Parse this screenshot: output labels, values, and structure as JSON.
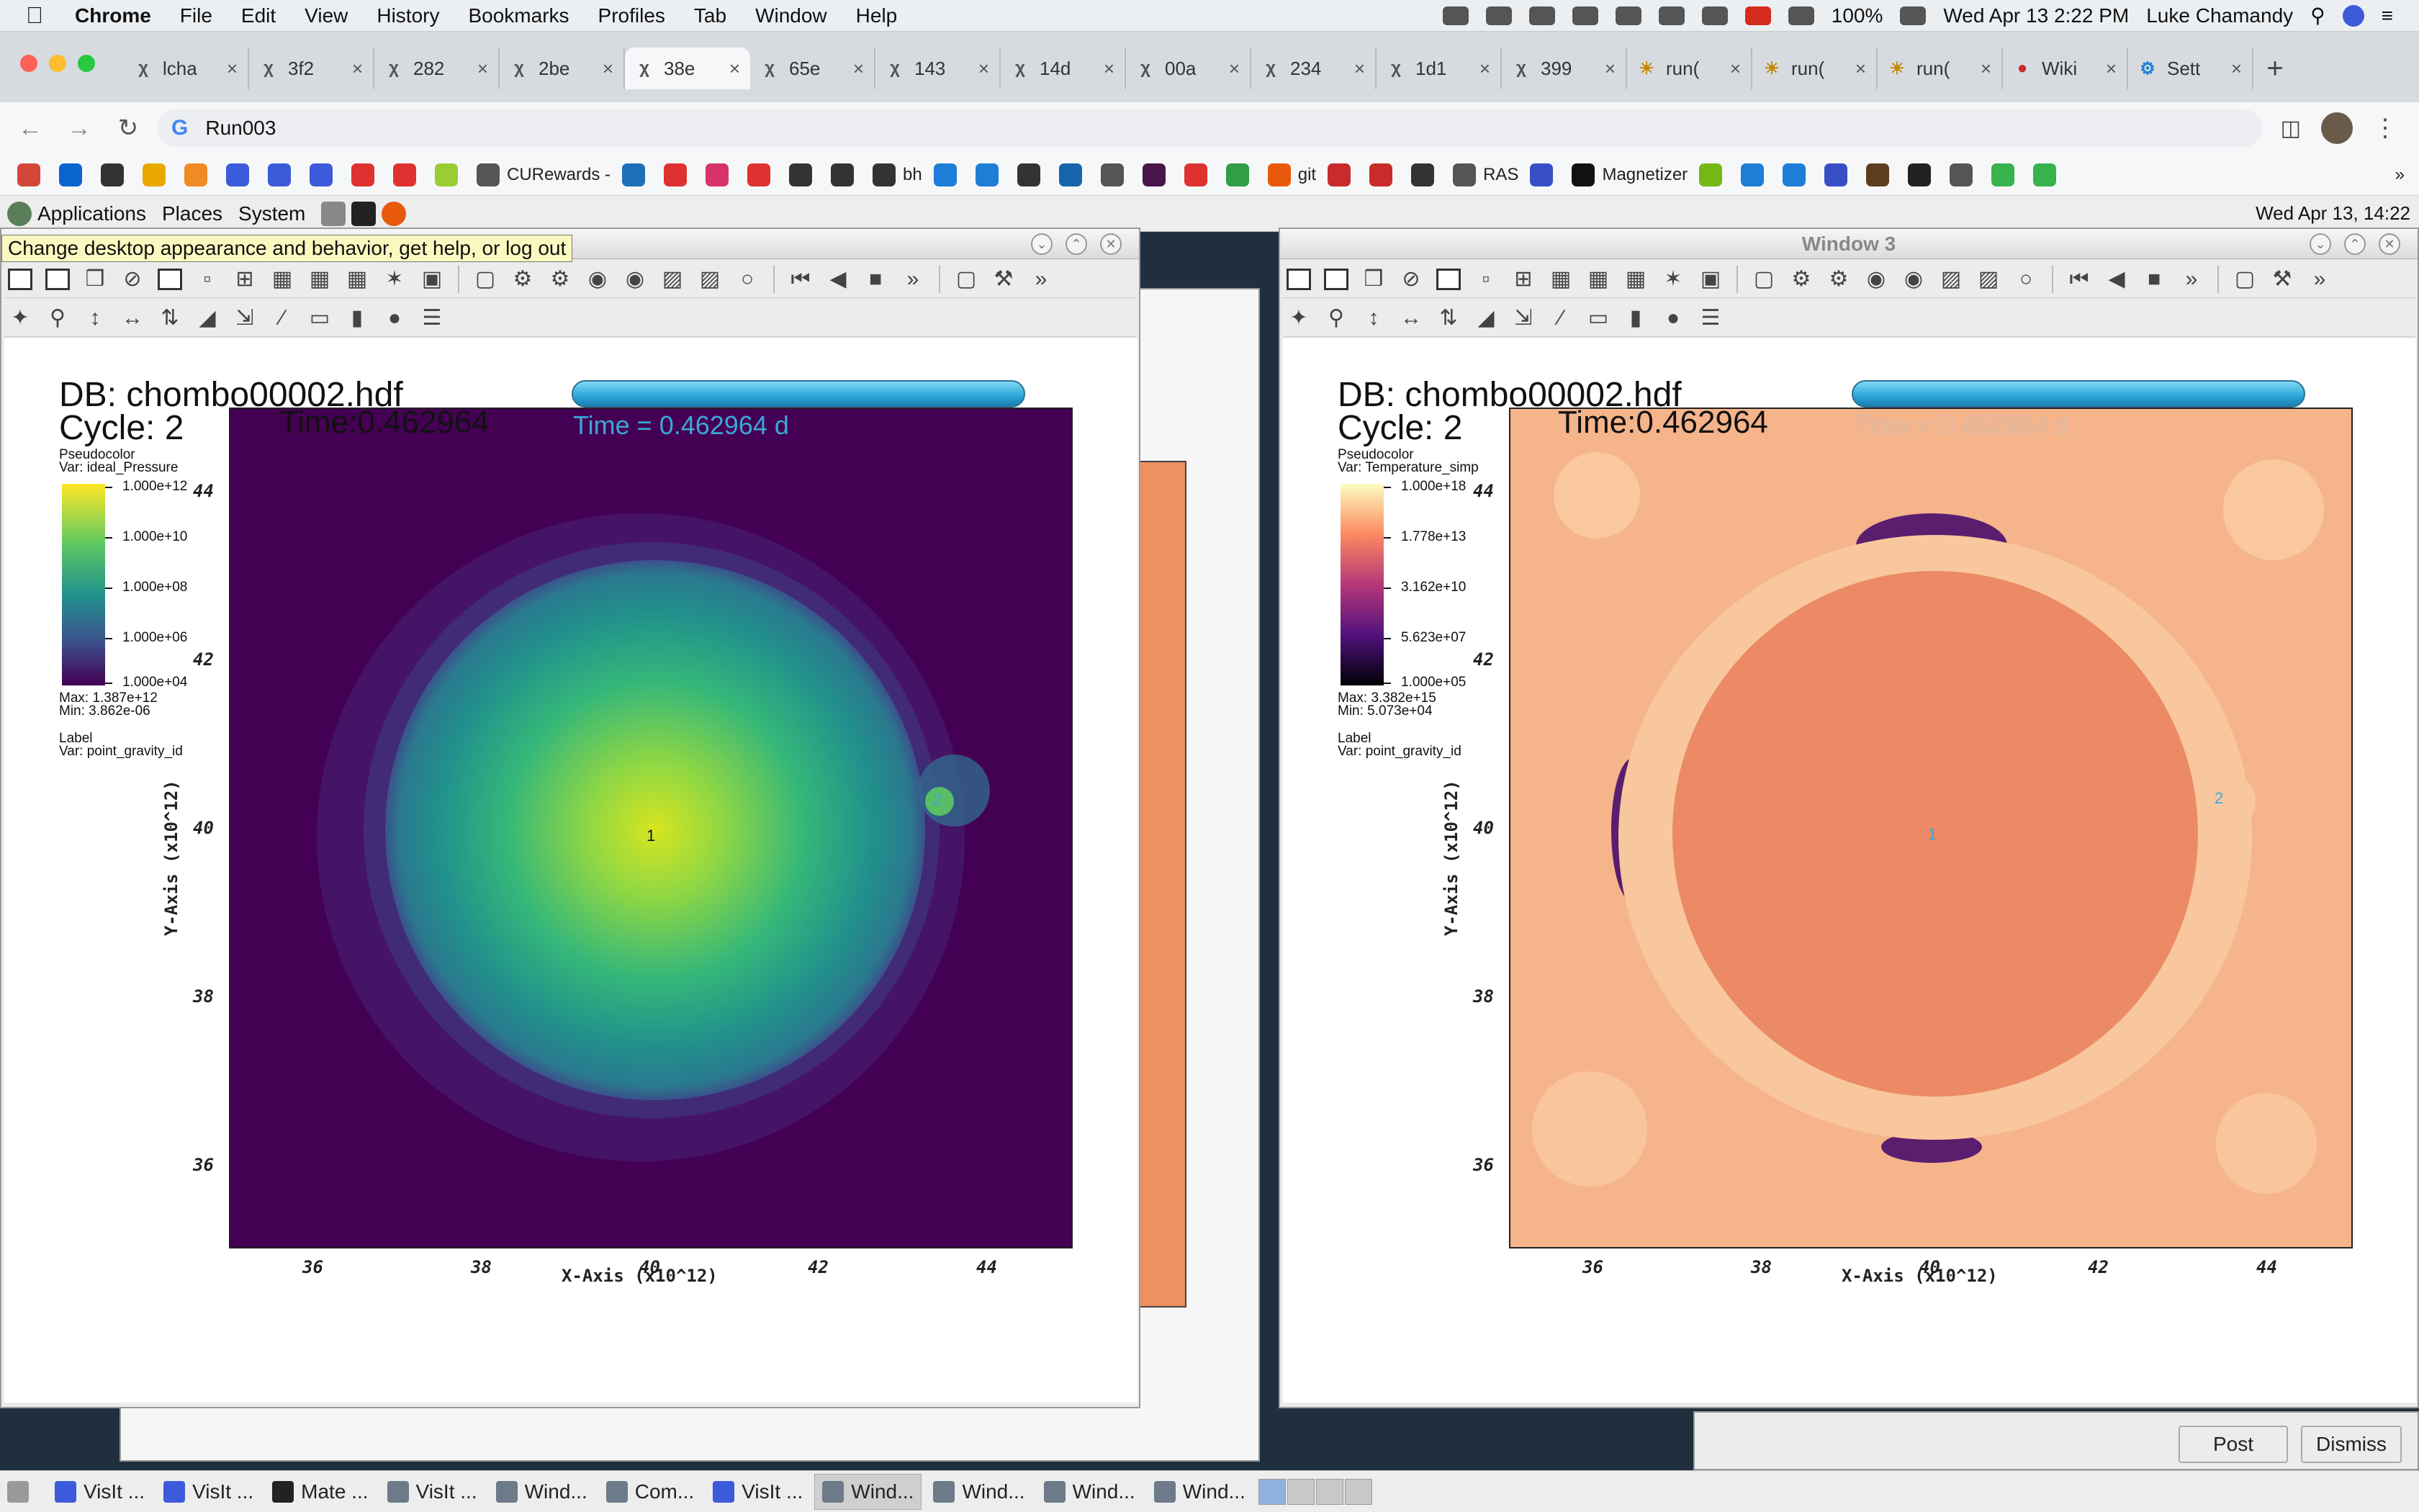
{
  "menubar": {
    "app": "Chrome",
    "items": [
      "File",
      "Edit",
      "View",
      "History",
      "Bookmarks",
      "Profiles",
      "Tab",
      "Window",
      "Help"
    ],
    "battery": "100%",
    "datetime": "Wed Apr 13  2:22 PM",
    "user": "Luke Chamandy"
  },
  "tabs": [
    {
      "label": "lcha",
      "icon": "x"
    },
    {
      "label": "3f2 ",
      "icon": "x"
    },
    {
      "label": "282",
      "icon": "x"
    },
    {
      "label": "2be",
      "icon": "x"
    },
    {
      "label": "38e",
      "icon": "x",
      "active": true
    },
    {
      "label": "65e",
      "icon": "x"
    },
    {
      "label": "143",
      "icon": "x"
    },
    {
      "label": "14d",
      "icon": "x"
    },
    {
      "label": "00a",
      "icon": "x"
    },
    {
      "label": "234",
      "icon": "x"
    },
    {
      "label": "1d1",
      "icon": "x"
    },
    {
      "label": "399",
      "icon": "x"
    },
    {
      "label": "run(",
      "icon": "sun"
    },
    {
      "label": "run(",
      "icon": "sun"
    },
    {
      "label": "run(",
      "icon": "sun"
    },
    {
      "label": "Wiki",
      "icon": "paw"
    },
    {
      "label": "Sett",
      "icon": "gear"
    }
  ],
  "address": {
    "url": "Run003"
  },
  "bookmarks": [
    {
      "label": "",
      "color": "#d44638"
    },
    {
      "label": "",
      "color": "#0a64d0"
    },
    {
      "label": "",
      "color": "#333"
    },
    {
      "label": "",
      "color": "#e8a800"
    },
    {
      "label": "",
      "color": "#f08a24"
    },
    {
      "label": "",
      "color": "#3b5bdb"
    },
    {
      "label": "",
      "color": "#3b5bdb"
    },
    {
      "label": "",
      "color": "#3b5bdb"
    },
    {
      "label": "",
      "color": "#e03131"
    },
    {
      "label": "",
      "color": "#e03131"
    },
    {
      "label": "",
      "color": "#9acd32"
    },
    {
      "label": "CURewards -",
      "color": "#555"
    },
    {
      "label": "",
      "color": "#1e6fb8"
    },
    {
      "label": "",
      "color": "#e03131"
    },
    {
      "label": "",
      "color": "#d6336c"
    },
    {
      "label": "",
      "color": "#e03131"
    },
    {
      "label": "",
      "color": "#333"
    },
    {
      "label": "",
      "color": "#333"
    },
    {
      "label": "bh",
      "color": "#333"
    },
    {
      "label": "",
      "color": "#1c7ed6"
    },
    {
      "label": "",
      "color": "#1c7ed6"
    },
    {
      "label": "",
      "color": "#333"
    },
    {
      "label": "",
      "color": "#1864ab"
    },
    {
      "label": "",
      "color": "#555"
    },
    {
      "label": "",
      "color": "#4a154b"
    },
    {
      "label": "",
      "color": "#e03131"
    },
    {
      "label": "",
      "color": "#2f9e44"
    },
    {
      "label": "git",
      "color": "#e8590c"
    },
    {
      "label": "",
      "color": "#c92a2a"
    },
    {
      "label": "",
      "color": "#c92a2a"
    },
    {
      "label": "",
      "color": "#333"
    },
    {
      "label": "RAS",
      "color": "#555"
    },
    {
      "label": "",
      "color": "#364fc7"
    },
    {
      "label": "Magnetizer",
      "color": "#111"
    },
    {
      "label": "",
      "color": "#74b816"
    },
    {
      "label": "",
      "color": "#1c7ed6"
    },
    {
      "label": "",
      "color": "#1c7ed6"
    },
    {
      "label": "",
      "color": "#364fc7"
    },
    {
      "label": "",
      "color": "#5c3d1e"
    },
    {
      "label": "",
      "color": "#222"
    },
    {
      "label": "",
      "color": "#555"
    },
    {
      "label": "",
      "color": "#37b24d"
    },
    {
      "label": "",
      "color": "#37b24d"
    }
  ],
  "gnome": {
    "items": [
      "Applications",
      "Places",
      "System"
    ],
    "clock": "Wed Apr 13, 14:22"
  },
  "tooltip": "Change desktop appearance and behavior, get help, or log out",
  "left_window": {
    "db": "DB: chombo00002.hdf",
    "cycle": "Cycle: 2",
    "time": "Time:0.462964",
    "time_annotation": "Time = 0.462964 d",
    "legend": {
      "plot": "Pseudocolor",
      "var": "Var: ideal_Pressure",
      "ticks": [
        "1.000e+12",
        "1.000e+10",
        "1.000e+08",
        "1.000e+06",
        "1.000e+04"
      ],
      "max": "Max:  1.387e+12",
      "min": "Min:  3.862e-06",
      "label": "Label",
      "label_var": "Var: point_gravity_id"
    }
  },
  "right_window": {
    "title": "Window 3",
    "db": "DB: chombo00002.hdf",
    "cycle": "Cycle: 2",
    "time": "Time:0.462964",
    "time_annotation": "Time = 0.462964 d",
    "legend": {
      "plot": "Pseudocolor",
      "var": "Var: Temperature_simp",
      "ticks": [
        "1.000e+18",
        "1.778e+13",
        "3.162e+10",
        "5.623e+07",
        "1.000e+05"
      ],
      "max": "Max:  3.382e+15",
      "min": "Min:  5.073e+04",
      "label": "Label",
      "label_var": "Var: point_gravity_id"
    }
  },
  "axes": {
    "xlabel": "X-Axis (x10^12)",
    "ylabel": "Y-Axis (x10^12)",
    "xticks": [
      "36",
      "38",
      "40",
      "42",
      "44"
    ],
    "yticks": [
      "44",
      "42",
      "40",
      "38",
      "36"
    ]
  },
  "point_labels": [
    "1",
    "2"
  ],
  "dialog": {
    "post": "Post",
    "dismiss": "Dismiss"
  },
  "taskbar": [
    {
      "label": "VisIt ...",
      "icon": "visit"
    },
    {
      "label": "VisIt ...",
      "icon": "visit"
    },
    {
      "label": "Mate ...",
      "icon": "terminal"
    },
    {
      "label": "VisIt ...",
      "icon": "window"
    },
    {
      "label": "Wind...",
      "icon": "window"
    },
    {
      "label": "Com...",
      "icon": "window"
    },
    {
      "label": "VisIt ...",
      "icon": "visit"
    },
    {
      "label": "Wind...",
      "icon": "window",
      "active": true
    },
    {
      "label": "Wind...",
      "icon": "window"
    },
    {
      "label": "Wind...",
      "icon": "window"
    },
    {
      "label": "Wind...",
      "icon": "window"
    }
  ],
  "colors": {
    "viridis_low": "#440154",
    "viridis_high": "#fde725",
    "magma_low": "#000004",
    "magma_high": "#fcfdbf",
    "accent": "#2aa6d8"
  }
}
